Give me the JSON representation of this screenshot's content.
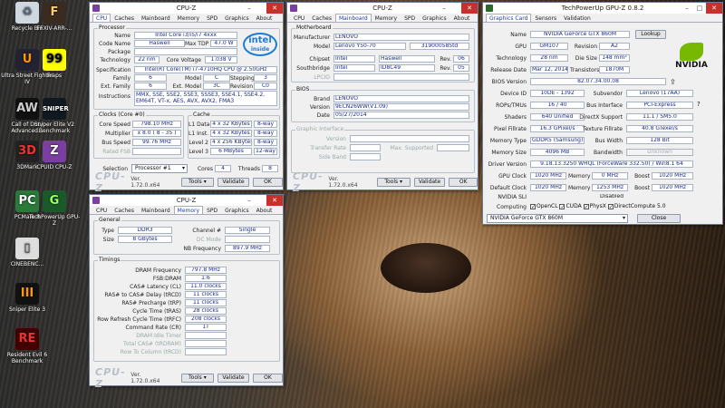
{
  "desktop": {
    "icons": [
      "Recycle Bin",
      "FFXIV-ARR-...",
      "Ultra Street Fighter IV",
      "Fraps",
      "Call of Duty Advanced...",
      "Sniper Elite V2 Benchmark",
      "3DMark",
      "CPUID CPU-Z",
      "PCMark 8",
      "TechPowerUp GPU-Z",
      "CINEBENC...",
      "Sniper Elite 3",
      "Resident Evil 6 Benchmark"
    ]
  },
  "cpuz1": {
    "title": "CPU-Z",
    "tabs": [
      "CPU",
      "Caches",
      "Mainboard",
      "Memory",
      "SPD",
      "Graphics",
      "About"
    ],
    "active": 0,
    "processor": {
      "group": "Processor",
      "name_l": "Name",
      "name": "Intel Core i3/i5/i7 4xxx",
      "code_l": "Code Name",
      "code": "Haswell",
      "tdp_l": "Max TDP",
      "tdp": "47.0 W",
      "pkg_l": "Package",
      "pkg": "",
      "tech_l": "Technology",
      "tech": "22 nm",
      "cv_l": "Core Voltage",
      "cv": "1.038 V",
      "spec_l": "Specification",
      "spec": "Intel(R) Core(TM) i7-4710HQ CPU @ 2.50GHz",
      "fam_l": "Family",
      "fam": "6",
      "model_l": "Model",
      "model": "C",
      "step_l": "Stepping",
      "step": "3",
      "efam_l": "Ext. Family",
      "efam": "6",
      "emodel_l": "Ext. Model",
      "emodel": "3C",
      "rev_l": "Revision",
      "rev": "C0",
      "instr_l": "Instructions",
      "instr": "MMX, SSE, SSE2, SSE3, SSSE3, SSE4.1, SSE4.2, EM64T, VT-x, AES, AVX, AVX2, FMA3",
      "logo_top": "intel",
      "logo_bottom": "inside"
    },
    "clocks": {
      "group": "Clocks (Core #0)",
      "cs_l": "Core Speed",
      "cs": "798.10 MHz",
      "mul_l": "Multiplier",
      "mul": "x 8.0 ( 8 - 35 )",
      "bus_l": "Bus Speed",
      "bus": "99.76 MHz",
      "fsb_l": "Rated FSB",
      "fsb": ""
    },
    "cache": {
      "group": "Cache",
      "l1d_l": "L1 Data",
      "l1d": "4 x 32 KBytes",
      "l1d_w": "8-way",
      "l1i_l": "L1 Inst.",
      "l1i": "4 x 32 KBytes",
      "l1i_w": "8-way",
      "l2_l": "Level 2",
      "l2": "4 x 256 KBytes",
      "l2_w": "8-way",
      "l3_l": "Level 3",
      "l3": "6 MBytes",
      "l3_w": "12-way"
    },
    "sel_l": "Selection",
    "sel": "Processor #1",
    "cores_l": "Cores",
    "cores": "4",
    "threads_l": "Threads",
    "threads": "8",
    "logo": "CPU-Z",
    "ver": "Ver. 1.72.0.x64",
    "tools": "Tools",
    "validate": "Validate",
    "ok": "OK"
  },
  "cpuz2": {
    "title": "CPU-Z",
    "tabs": [
      "CPU",
      "Caches",
      "Mainboard",
      "Memory",
      "SPD",
      "Graphics",
      "About"
    ],
    "active": 2,
    "mb": {
      "group": "Motherboard",
      "man_l": "Manufacturer",
      "man": "LENOVO",
      "model_l": "Model",
      "model": "Lenovo Y50-70",
      "model2": "31900058Std",
      "chip_l": "Chipset",
      "chip": "Intel",
      "chip2": "Haswell",
      "rev_l": "Rev.",
      "chiprev": "06",
      "south_l": "Southbridge",
      "south": "Intel",
      "south2": "ID8C49",
      "southrev": "05",
      "lpcio_l": "LPCIO",
      "lpcio": ""
    },
    "bios": {
      "group": "BIOS",
      "brand_l": "Brand",
      "brand": "LENOVO",
      "ver_l": "Version",
      "ver": "9ECN26WW(V1.09)",
      "date_l": "Date",
      "date": "05/27/2014"
    },
    "gi": {
      "group": "Graphic Interface",
      "ver_l": "Version",
      "tr_l": "Transfer Rate",
      "max_l": "Max. Supported",
      "sb_l": "Side Band"
    },
    "logo": "CPU-Z",
    "ver": "Ver. 1.72.0.x64",
    "tools": "Tools",
    "validate": "Validate",
    "ok": "OK"
  },
  "cpuz3": {
    "title": "CPU-Z",
    "tabs": [
      "CPU",
      "Caches",
      "Mainboard",
      "Memory",
      "SPD",
      "Graphics",
      "About"
    ],
    "active": 3,
    "gen": {
      "group": "General",
      "type_l": "Type",
      "type": "DDR3",
      "ch_l": "Channel #",
      "ch": "Single",
      "size_l": "Size",
      "size": "8 GBytes",
      "dc_l": "DC Mode",
      "nb_l": "NB Frequency",
      "nb": "897.9 MHz"
    },
    "tim": {
      "group": "Timings",
      "rows": [
        {
          "l": "DRAM Frequency",
          "v": "797.8 MHz"
        },
        {
          "l": "FSB:DRAM",
          "v": "1:6"
        },
        {
          "l": "CAS# Latency (CL)",
          "v": "11.0 clocks"
        },
        {
          "l": "RAS# to CAS# Delay (tRCD)",
          "v": "11 clocks"
        },
        {
          "l": "RAS# Precharge (tRP)",
          "v": "11 clocks"
        },
        {
          "l": "Cycle Time (tRAS)",
          "v": "28 clocks"
        },
        {
          "l": "Row Refresh Cycle Time (tRFC)",
          "v": "208 clocks"
        },
        {
          "l": "Command Rate (CR)",
          "v": "1T"
        },
        {
          "l": "DRAM Idle Timer",
          "v": ""
        },
        {
          "l": "Total CAS# (tRDRAM)",
          "v": ""
        },
        {
          "l": "Row To Column (tRCD)",
          "v": ""
        }
      ]
    },
    "logo": "CPU-Z",
    "ver": "Ver. 1.72.0.x64",
    "tools": "Tools",
    "validate": "Validate",
    "ok": "OK"
  },
  "gpuz": {
    "title": "TechPowerUp GPU-Z 0.8.2",
    "tabs": [
      "Graphics Card",
      "Sensors",
      "Validation"
    ],
    "name_l": "Name",
    "name": "NVIDIA GeForce GTX 860M",
    "lookup": "Lookup",
    "gpu_l": "GPU",
    "gpu": "GM107",
    "rev_l": "Revision",
    "rev": "A2",
    "tech_l": "Technology",
    "tech": "28 nm",
    "die_l": "Die Size",
    "die": "148 mm²",
    "rel_l": "Release Date",
    "rel": "Mar 12, 2014",
    "tr_l": "Transistors",
    "tr": "1870M",
    "bios_l": "BIOS Version",
    "bios": "82.07.34.00.08",
    "dev_l": "Device ID",
    "dev": "10DE - 1392",
    "sub_l": "Subvendor",
    "sub": "Lenovo (17AA)",
    "rops_l": "ROPs/TMUs",
    "rops": "16 / 40",
    "bus_l": "Bus Interface",
    "bus": "PCI-Express",
    "sh_l": "Shaders",
    "sh": "640 Unified",
    "dx_l": "DirectX Support",
    "dx": "11.1 / SM5.0",
    "pf_l": "Pixel Fillrate",
    "pf": "16.3 GPixel/s",
    "tf_l": "Texture Fillrate",
    "tf": "40.8 GTexel/s",
    "mt_l": "Memory Type",
    "mt": "GDDR5 (Samsung)",
    "bw_l": "Bus Width",
    "bw": "128 Bit",
    "ms_l": "Memory Size",
    "ms": "4096 MB",
    "band_l": "Bandwidth",
    "band": "Unknown",
    "drv_l": "Driver Version",
    "drv": "9.18.13.3250 WHQL (ForceWare 332.50) / Win8.1 64",
    "gc_l": "GPU Clock",
    "gc": "1020 MHz",
    "mem_l": "Memory",
    "gcm": "0 MHz",
    "boost_l": "Boost",
    "gcb": "1020 MHz",
    "dc_l": "Default Clock",
    "dc": "1020 MHz",
    "dcm": "1253 MHz",
    "dcb": "1020 MHz",
    "sli_l": "NVIDIA SLI",
    "sli": "Disabled",
    "comp_l": "Computing",
    "opencl": "OpenCL",
    "cuda": "CUDA",
    "physx": "PhysX",
    "dcomp": "DirectCompute 5.0",
    "sel": "NVIDIA GeForce GTX 860M",
    "close": "Close",
    "logo": "NVIDIA"
  }
}
